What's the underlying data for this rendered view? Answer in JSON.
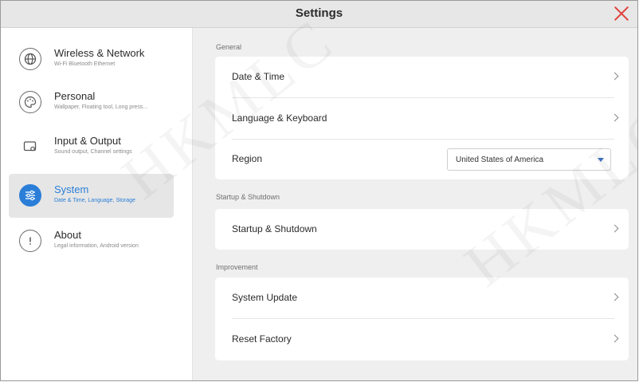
{
  "window": {
    "title": "Settings"
  },
  "sidebar": {
    "items": [
      {
        "label": "Wireless & Network",
        "sub": "Wi-Fi Bluetooth Ethernet",
        "icon": "globe-icon"
      },
      {
        "label": "Personal",
        "sub": "Wallpaper, Floating tool, Long press...",
        "icon": "palette-icon"
      },
      {
        "label": "Input & Output",
        "sub": "Sound output, Channel settings",
        "icon": "monitor-input-icon"
      },
      {
        "label": "System",
        "sub": "Date & Time, Language, Storage",
        "icon": "sliders-icon",
        "selected": true
      },
      {
        "label": "About",
        "sub": "Legal information, Android version",
        "icon": "info-icon"
      }
    ]
  },
  "main": {
    "general": {
      "label": "General",
      "rows": [
        {
          "label": "Date & Time"
        },
        {
          "label": "Language & Keyboard"
        },
        {
          "label": "Region"
        }
      ],
      "region_value": "United States of America"
    },
    "startup": {
      "label": "Startup & Shutdown",
      "row": "Startup & Shutdown"
    },
    "improvement": {
      "label": "Improvement",
      "rows": [
        {
          "label": "System Update"
        },
        {
          "label": "Reset Factory"
        }
      ]
    }
  },
  "watermark": "HKMLC",
  "colors": {
    "accent": "#2b7ed8",
    "close": "#e0413b",
    "background": "#efefef"
  }
}
